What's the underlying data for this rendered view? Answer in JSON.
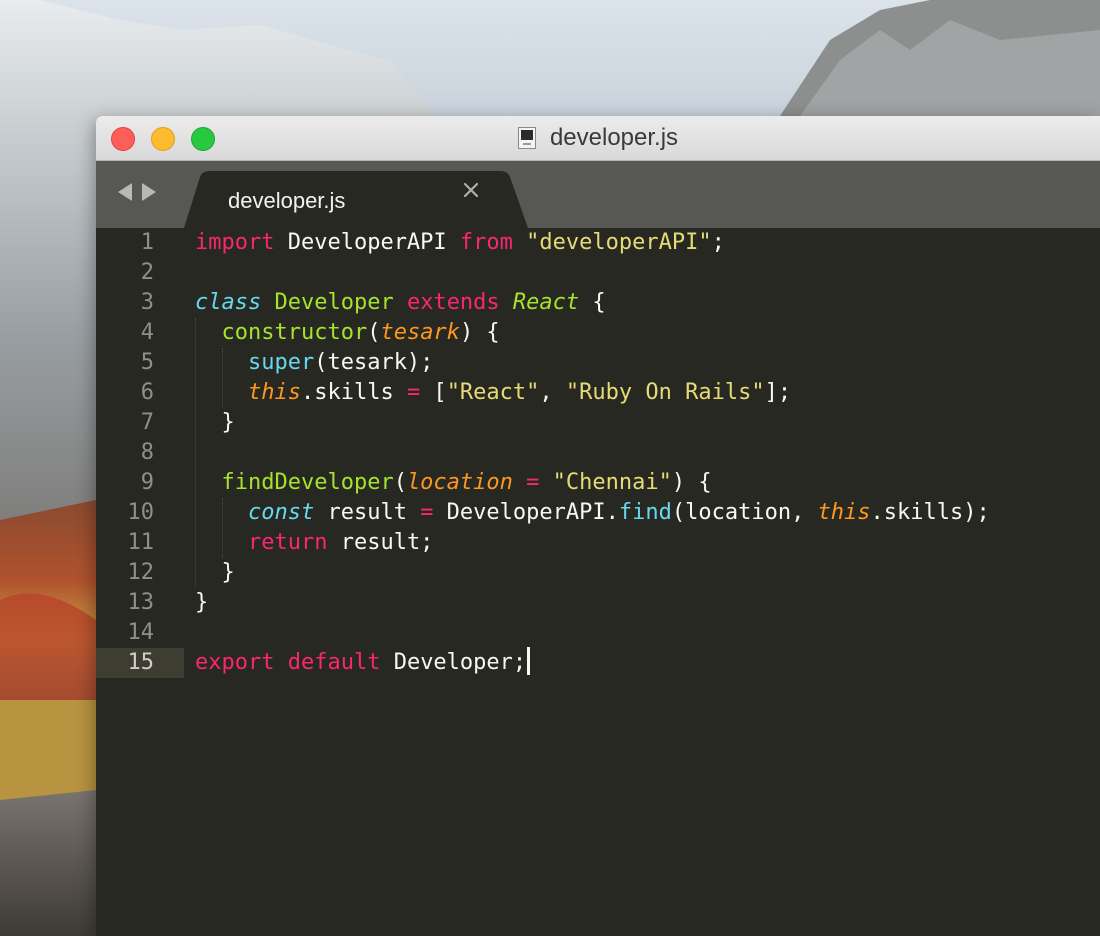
{
  "window": {
    "title": "developer.js"
  },
  "tabs": [
    {
      "label": "developer.js",
      "active": true
    }
  ],
  "editor": {
    "active_line": 15,
    "line_numbers": [
      "1",
      "2",
      "3",
      "4",
      "5",
      "6",
      "7",
      "8",
      "9",
      "10",
      "11",
      "12",
      "13",
      "14",
      "15"
    ],
    "lines": [
      [
        [
          "kw",
          "import"
        ],
        [
          "p",
          " DeveloperAPI "
        ],
        [
          "kw",
          "from"
        ],
        [
          "p",
          " "
        ],
        [
          "s",
          "\"developerAPI\""
        ],
        [
          "p",
          ";"
        ]
      ],
      [],
      [
        [
          "ki",
          "class"
        ],
        [
          "p",
          " "
        ],
        [
          "c",
          "Developer"
        ],
        [
          "p",
          " "
        ],
        [
          "kw",
          "extends"
        ],
        [
          "p",
          " "
        ],
        [
          "ci",
          "React"
        ],
        [
          "p",
          " {"
        ]
      ],
      [
        [
          "p",
          "  "
        ],
        [
          "c",
          "constructor"
        ],
        [
          "p",
          "("
        ],
        [
          "a",
          "tesark"
        ],
        [
          "p",
          ") {"
        ]
      ],
      [
        [
          "p",
          "    "
        ],
        [
          "f",
          "super"
        ],
        [
          "p",
          "(tesark);"
        ]
      ],
      [
        [
          "p",
          "    "
        ],
        [
          "a",
          "this"
        ],
        [
          "p",
          ".skills "
        ],
        [
          "kw",
          "="
        ],
        [
          "p",
          " ["
        ],
        [
          "s",
          "\"React\""
        ],
        [
          "p",
          ", "
        ],
        [
          "s",
          "\"Ruby On Rails\""
        ],
        [
          "p",
          "];"
        ]
      ],
      [
        [
          "p",
          "  }"
        ]
      ],
      [],
      [
        [
          "p",
          "  "
        ],
        [
          "c",
          "findDeveloper"
        ],
        [
          "p",
          "("
        ],
        [
          "a",
          "location"
        ],
        [
          "p",
          " "
        ],
        [
          "kw",
          "="
        ],
        [
          "p",
          " "
        ],
        [
          "s",
          "\"Chennai\""
        ],
        [
          "p",
          ") {"
        ]
      ],
      [
        [
          "p",
          "    "
        ],
        [
          "ki",
          "const"
        ],
        [
          "p",
          " result "
        ],
        [
          "kw",
          "="
        ],
        [
          "p",
          " DeveloperAPI."
        ],
        [
          "f",
          "find"
        ],
        [
          "p",
          "(location, "
        ],
        [
          "a",
          "this"
        ],
        [
          "p",
          ".skills);"
        ]
      ],
      [
        [
          "p",
          "    "
        ],
        [
          "kw",
          "return"
        ],
        [
          "p",
          " result;"
        ]
      ],
      [
        [
          "p",
          "  }"
        ]
      ],
      [
        [
          "p",
          "}"
        ]
      ],
      [],
      [
        [
          "kw",
          "export"
        ],
        [
          "p",
          " "
        ],
        [
          "kw",
          "default"
        ],
        [
          "p",
          " Developer;"
        ]
      ]
    ]
  },
  "colors": {
    "background": "#272822",
    "keyword": "#f92672",
    "storage": "#66d9ef",
    "entity": "#a6e22e",
    "string": "#e6db74",
    "parameter": "#fd971f",
    "text": "#f8f8f2"
  },
  "icons": {
    "back": "left-triangle",
    "forward": "right-triangle",
    "tab_close": "x-mark",
    "file": "document-js"
  }
}
